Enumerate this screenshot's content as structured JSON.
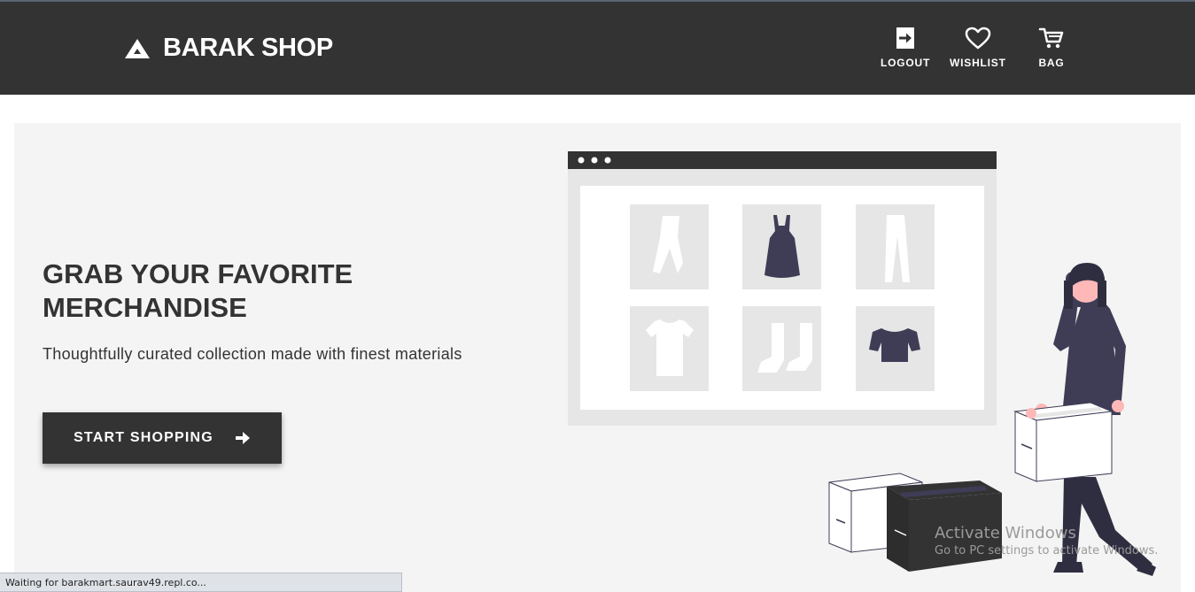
{
  "header": {
    "brand": "BARAK SHOP",
    "nav": [
      {
        "label": "LOGOUT",
        "icon": "logout-icon"
      },
      {
        "label": "WISHLIST",
        "icon": "heart-icon"
      },
      {
        "label": "BAG",
        "icon": "cart-icon"
      }
    ]
  },
  "hero": {
    "title": "GRAB YOUR FAVORITE MERCHANDISE",
    "subtitle": "Thoughtfully curated collection made with finest materials",
    "cta_label": "START SHOPPING"
  },
  "status_bar": {
    "text": "Waiting for barakmart.saurav49.repl.co..."
  },
  "watermark": {
    "line1": "Activate Windows",
    "line2": "Go to PC settings to activate Windows."
  },
  "colors": {
    "header_bg": "#333333",
    "hero_bg": "#f4f4f4",
    "accent_dark": "#3f3d56",
    "accent_pink": "#ffb8b8"
  }
}
